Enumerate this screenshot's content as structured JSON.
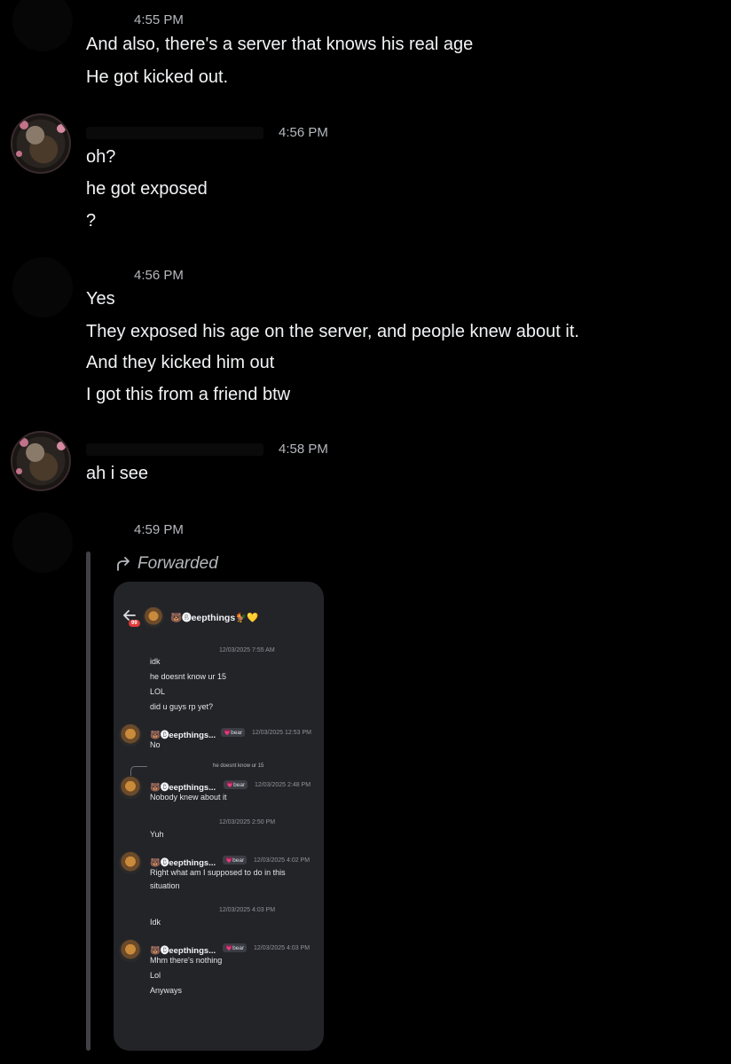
{
  "messages": [
    {
      "time": "4:55 PM",
      "lines": [
        "And also, there's a server that knows his real age",
        "He got kicked out."
      ]
    },
    {
      "time": "4:56 PM",
      "lines": [
        "oh?",
        "he got exposed",
        "?"
      ]
    },
    {
      "time": "4:56 PM",
      "lines": [
        "Yes",
        "They exposed his age on the server, and people knew about it.",
        "And they kicked him out",
        "I got this from a friend btw"
      ]
    },
    {
      "time": "4:58 PM",
      "lines": [
        "ah i see"
      ]
    },
    {
      "time": "4:59 PM",
      "forwarded_label": "Forwarded"
    }
  ],
  "forwarded_screenshot": {
    "back_badge": "99",
    "header_title": "🐻🅑eepthings🐓💛",
    "items": [
      {
        "time": "12/03/2025 7:55 AM",
        "lines": [
          "idk",
          "he doesnt know ur 15",
          "LOL",
          "did u guys rp yet?"
        ]
      },
      {
        "name": "🐻🅑eepthings...",
        "tag": "💗bear",
        "time": "12/03/2025 12:53 PM",
        "lines": [
          "No"
        ]
      },
      {
        "reply": "he doesnt know ur 15",
        "name": "🐻🅑eepthings...",
        "tag": "💗bear",
        "time": "12/03/2025 2:48 PM",
        "lines": [
          "Nobody knew about it"
        ]
      },
      {
        "time": "12/03/2025 2:50 PM",
        "lines": [
          "Yuh"
        ]
      },
      {
        "name": "🐻🅑eepthings...",
        "tag": "💗bear",
        "time": "12/03/2025 4:02 PM",
        "lines": [
          "Right what am I supposed to do in this",
          "situation"
        ]
      },
      {
        "time": "12/03/2025 4:03 PM",
        "lines": [
          "Idk"
        ]
      },
      {
        "name": "🐻🅑eepthings...",
        "tag": "💗bear",
        "time": "12/03/2025 4:03 PM",
        "lines": [
          "Mhm there's nothing",
          "Lol",
          "Anyways"
        ]
      }
    ]
  },
  "colors": {
    "background": "#000000",
    "text": "#f2f3f5",
    "timestamp": "#b5b8bd",
    "embed_bg": "#232428",
    "forward_bar": "#3f4147"
  }
}
